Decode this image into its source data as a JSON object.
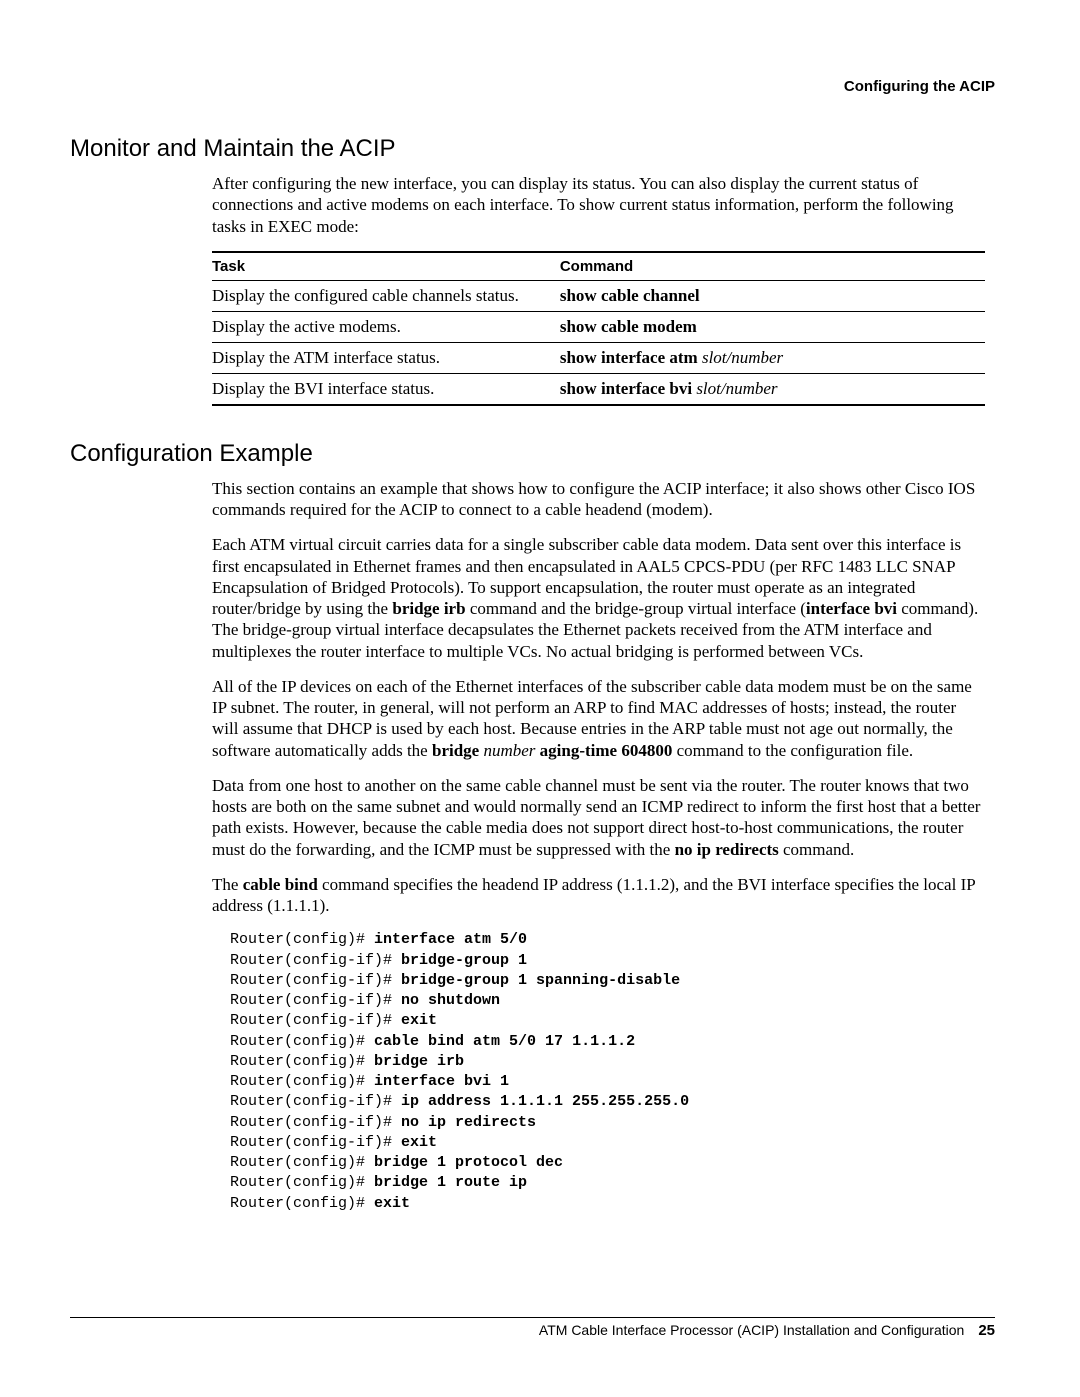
{
  "header": {
    "running": "Configuring the ACIP"
  },
  "section1": {
    "title": "Monitor and Maintain the ACIP",
    "intro": "After configuring the new interface, you can display its status. You can also display the current status of connections and active modems on each interface. To show current status information, perform the following tasks in EXEC mode:",
    "table": {
      "head_task": "Task",
      "head_cmd": "Command",
      "rows": [
        {
          "task": "Display the configured cable channels status.",
          "cmd_b": "show cable channel",
          "cmd_i": ""
        },
        {
          "task": "Display the active modems.",
          "cmd_b": "show cable modem",
          "cmd_i": ""
        },
        {
          "task": "Display the ATM interface status.",
          "cmd_b": "show interface atm ",
          "cmd_i": "slot/number"
        },
        {
          "task": "Display the BVI interface status.",
          "cmd_b": "show interface bvi ",
          "cmd_i": "slot/number"
        }
      ]
    }
  },
  "section2": {
    "title": "Configuration Example",
    "p1": "This section contains an example that shows how to configure the ACIP interface; it also shows other Cisco IOS commands required for the ACIP to connect to a cable headend (modem).",
    "p2a": "Each ATM virtual circuit carries data for a single subscriber cable data modem. Data sent over this interface is first encapsulated in Ethernet frames and then encapsulated in AAL5 CPCS-PDU (per RFC 1483 LLC SNAP Encapsulation of Bridged Protocols). To support encapsulation, the router must operate as an integrated router/bridge by using the ",
    "p2b": "bridge irb",
    "p2c": " command and the bridge-group virtual interface (",
    "p2d": "interface bvi",
    "p2e": " command). The bridge-group virtual interface decapsulates the Ethernet packets received from the ATM interface and multiplexes the router interface to multiple VCs. No actual bridging is performed between VCs.",
    "p3a": "All of the IP devices on each of the Ethernet interfaces of the subscriber cable data modem must be on the same IP subnet. The router, in general, will not perform an ARP to find MAC addresses of hosts; instead, the router will assume that DHCP is used by each host. Because entries in the ARP table must not age out normally, the software automatically adds the ",
    "p3b": "bridge",
    "p3c": " ",
    "p3d": "number",
    "p3e": " ",
    "p3f": "aging-time 604800",
    "p3g": " command to the configuration file.",
    "p4a": "Data from one host to another on the same cable channel must be sent via the router. The router knows that two hosts are both on the same subnet and would normally send an ICMP redirect to inform the first host that a better path exists. However, because the cable media does not support direct host-to-host communications, the router must do the forwarding, and the ICMP must be suppressed with the ",
    "p4b": "no ip redirects",
    "p4c": " command.",
    "p5a": "The ",
    "p5b": "cable bind",
    "p5c": " command specifies the headend IP address (1.1.1.2), and the BVI interface specifies the local IP address (1.1.1.1).",
    "code": [
      {
        "p": "Router(config)# ",
        "b": "interface atm 5/0"
      },
      {
        "p": "Router(config-if)# ",
        "b": "bridge-group 1"
      },
      {
        "p": "Router(config-if)# ",
        "b": "bridge-group 1 spanning-disable"
      },
      {
        "p": "Router(config-if)# ",
        "b": "no shutdown"
      },
      {
        "p": "Router(config-if)# ",
        "b": "exit"
      },
      {
        "p": "Router(config)# ",
        "b": "cable bind atm 5/0 17 1.1.1.2"
      },
      {
        "p": "Router(config)# ",
        "b": "bridge irb"
      },
      {
        "p": "Router(config)# ",
        "b": "interface bvi 1"
      },
      {
        "p": "Router(config-if)# ",
        "b": "ip address 1.1.1.1 255.255.255.0"
      },
      {
        "p": "Router(config-if)# ",
        "b": "no ip redirects"
      },
      {
        "p": "Router(config-if)# ",
        "b": "exit"
      },
      {
        "p": "Router(config)# ",
        "b": "bridge 1 protocol dec"
      },
      {
        "p": "Router(config)# ",
        "b": "bridge 1 route ip"
      },
      {
        "p": "Router(config)# ",
        "b": "exit"
      }
    ]
  },
  "footer": {
    "doc": "ATM Cable Interface Processor (ACIP) Installation and Configuration",
    "page": "25"
  }
}
